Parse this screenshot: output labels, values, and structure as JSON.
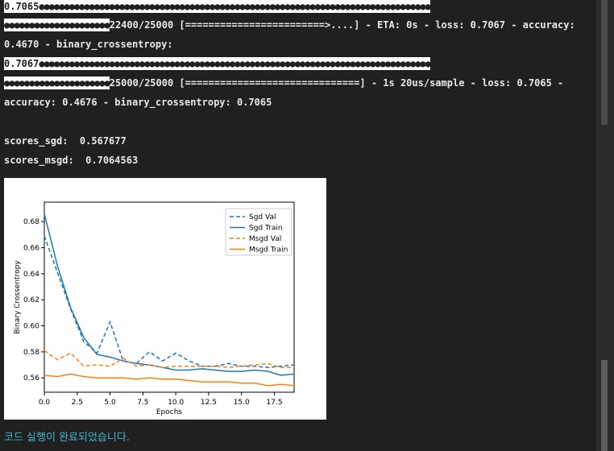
{
  "console": {
    "line1_value": "0.7065",
    "line1_bullets": "●●●●●●●●●●●●●●●●●●●●●●●●●●●●●●●●●●●●●●●●●●●●●●●●●●●●●●●●●●●●●●●●●●●●●●●●●●●●●●",
    "line2_bullets": "●●●●●●●●●●●●●●●●●●●●●",
    "line2_text": "22400/25000 [========================>....] - ETA: 0s - loss: 0.7067 - accuracy:",
    "line3_text": "0.4670 - binary_crossentropy:",
    "line4_value": "0.7067",
    "line4_bullets": "●●●●●●●●●●●●●●●●●●●●●●●●●●●●●●●●●●●●●●●●●●●●●●●●●●●●●●●●●●●●●●●●●●●●●●●●●●●●●●",
    "line5_bullets": "●●●●●●●●●●●●●●●●●●●●●",
    "line5_text": "25000/25000 [==============================] - 1s 20us/sample - loss: 0.7065 -",
    "line6_text": "accuracy: 0.4676 - binary_crossentropy: 0.7065",
    "scores_sgd": "scores_sgd:  0.567677",
    "scores_msgd": "scores_msgd:  0.7064563"
  },
  "status_text": "코드 실행이 완료되었습니다.",
  "chart_data": {
    "type": "line",
    "xlabel": "Epochs",
    "ylabel": "Binary Crossentropy",
    "xlim": [
      0,
      19
    ],
    "ylim": [
      0.549,
      0.695
    ],
    "xticks": [
      "0.0",
      "2.5",
      "5.0",
      "7.5",
      "10.0",
      "12.5",
      "15.0",
      "17.5"
    ],
    "yticks": [
      "0.56",
      "0.58",
      "0.60",
      "0.62",
      "0.64",
      "0.66",
      "0.68"
    ],
    "legend_position": "top-right",
    "x": [
      0,
      1,
      2,
      3,
      4,
      5,
      6,
      7,
      8,
      9,
      10,
      11,
      12,
      13,
      14,
      15,
      16,
      17,
      18,
      19
    ],
    "series": [
      {
        "name": "Sgd Val",
        "color": "#1f77b4",
        "dashed": true,
        "values": [
          0.669,
          0.641,
          0.613,
          0.588,
          0.579,
          0.603,
          0.573,
          0.571,
          0.58,
          0.573,
          0.579,
          0.573,
          0.569,
          0.569,
          0.571,
          0.569,
          0.569,
          0.568,
          0.569,
          0.57
        ]
      },
      {
        "name": "Sgd Train",
        "color": "#1f77b4",
        "dashed": false,
        "values": [
          0.686,
          0.646,
          0.614,
          0.591,
          0.578,
          0.576,
          0.573,
          0.571,
          0.57,
          0.568,
          0.566,
          0.566,
          0.567,
          0.566,
          0.565,
          0.565,
          0.566,
          0.565,
          0.562,
          0.563
        ]
      },
      {
        "name": "Msgd Val",
        "color": "#ff7f0e",
        "dashed": true,
        "values": [
          0.581,
          0.574,
          0.579,
          0.569,
          0.57,
          0.569,
          0.575,
          0.569,
          0.57,
          0.568,
          0.569,
          0.569,
          0.569,
          0.569,
          0.568,
          0.569,
          0.57,
          0.571,
          0.568,
          0.568
        ]
      },
      {
        "name": "Msgd Train",
        "color": "#ff7f0e",
        "dashed": false,
        "values": [
          0.562,
          0.561,
          0.563,
          0.561,
          0.56,
          0.56,
          0.56,
          0.559,
          0.56,
          0.559,
          0.559,
          0.558,
          0.557,
          0.557,
          0.557,
          0.556,
          0.556,
          0.554,
          0.555,
          0.554
        ]
      }
    ]
  }
}
